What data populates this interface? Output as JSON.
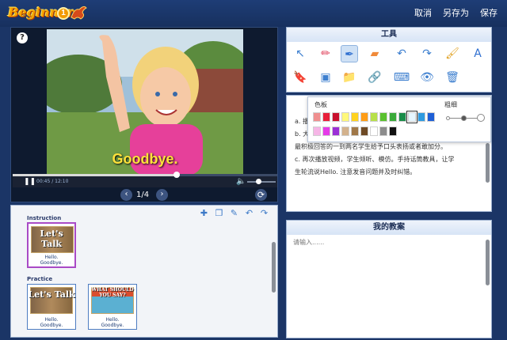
{
  "app": {
    "logo_text": "Beginner",
    "logo_level": "1"
  },
  "top_actions": {
    "cancel": "取消",
    "save_as": "另存为",
    "save": "保存"
  },
  "video": {
    "help": "?",
    "caption": "Goodbye.",
    "current_time": "00:45",
    "duration": "12:10",
    "progress": 0.62,
    "volume": 0.3,
    "page_indicator": "1/4"
  },
  "slides": {
    "sections": [
      {
        "label": "Instruction",
        "items": [
          {
            "title": "Let's Talk",
            "caption": "Hello.\nGoodbye."
          }
        ]
      },
      {
        "label": "Practice",
        "items": [
          {
            "title": "Let's Talk",
            "caption": "Hello.\nGoodbye."
          },
          {
            "title": "WHAT SHOULD YOU SAY?",
            "caption": "Hello.\nGoodbye."
          }
        ]
      }
    ]
  },
  "tools": {
    "title": "工具",
    "icons_row1": [
      "cursor-icon",
      "pencil-icon",
      "pen-icon",
      "eraser-icon",
      "undo-icon",
      "redo-icon",
      "brush-icon",
      "text-icon"
    ],
    "icons_row2": [
      "bookmark-icon",
      "screenshot-icon",
      "folder-icon",
      "link-icon",
      "keyboard-icon",
      "eye-icon",
      "trash-icon"
    ]
  },
  "color_popup": {
    "color_label": "色板",
    "size_label": "粗细",
    "colors_row1": [
      "#f08f8f",
      "#e8203a",
      "#c8102e",
      "#fff87a",
      "#ffd21f",
      "#ff9d16",
      "#b7e04a",
      "#5ac12f",
      "#3aaa3a",
      "#1a8c4a",
      "#e6f6ff",
      "#2f9be0",
      "#1f5fd6"
    ],
    "colors_row2": [
      "#f6b6e6",
      "#e53be8",
      "#9b2fd6",
      "#d3b28d",
      "#a07848",
      "#6e4a25",
      "#ffffff",
      "#8c8c8c",
      "#111111"
    ],
    "selected_color_index": 10
  },
  "text_content": {
    "lines": [
      "a. 播",
      "b. 大",
      "最积极回答的一到两名学生给予口头表扬或者敢加分。",
      "c. 再次播放视频，学生倾听、模仿。手持话筒教具，让学",
      "生轮流说Hello. 注意发音问题并及时纠错。"
    ]
  },
  "notes": {
    "title": "我的教案",
    "placeholder": "请输入......"
  }
}
